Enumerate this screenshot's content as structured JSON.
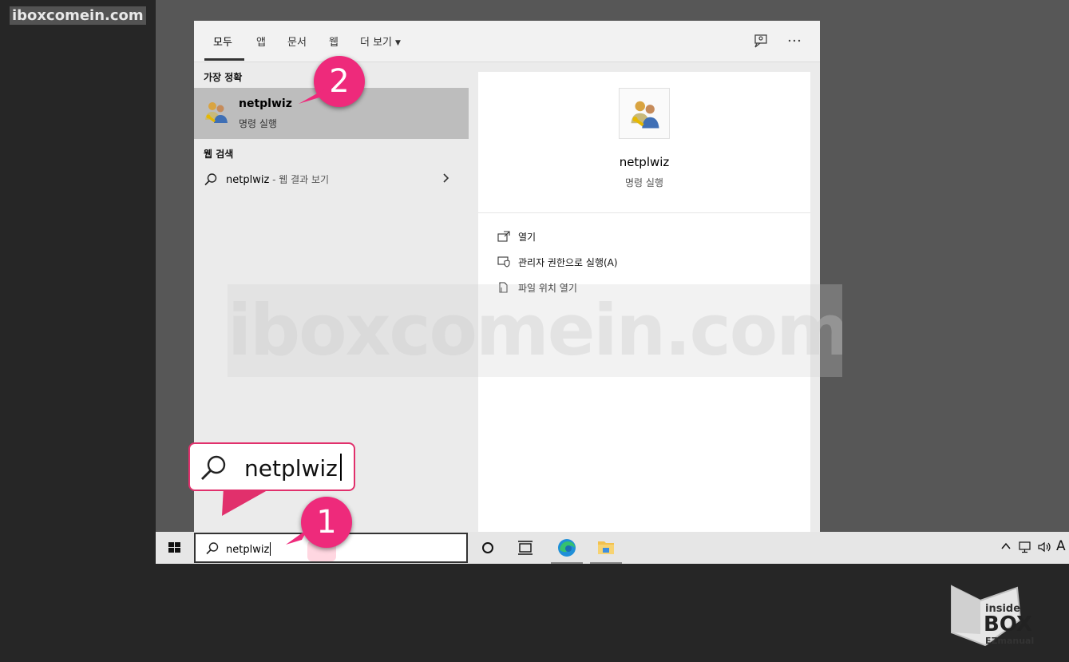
{
  "watermark": {
    "site": "iboxcomein.com"
  },
  "tabs": [
    {
      "label": "모두"
    },
    {
      "label": "앱"
    },
    {
      "label": "문서"
    },
    {
      "label": "웹"
    },
    {
      "label": "더 보기"
    }
  ],
  "left": {
    "best_match_heading": "가장 정확",
    "best_match": {
      "title": "netplwiz",
      "subtitle": "명령 실행"
    },
    "web_heading": "웹 검색",
    "web_result": {
      "query": "netplwiz",
      "suffix": " - 웹 결과 보기"
    }
  },
  "right": {
    "title": "netplwiz",
    "subtitle": "명령 실행",
    "actions": [
      {
        "label": "열기"
      },
      {
        "label": "관리자 권한으로 실행(A)"
      },
      {
        "label": "파일 위치 열기"
      }
    ]
  },
  "taskbar": {
    "search_value": "netplwiz",
    "tray_letter": "A"
  },
  "callout": {
    "text": "netplwiz"
  },
  "badges": [
    "1",
    "2"
  ],
  "brand": {
    "line1": "inside",
    "line2": "BOX",
    "line3": "EZmanual"
  },
  "colors": {
    "accent": "#ee2a7b",
    "selected_row": "#bdbdbd",
    "panel_bg": "#ebebeb"
  }
}
